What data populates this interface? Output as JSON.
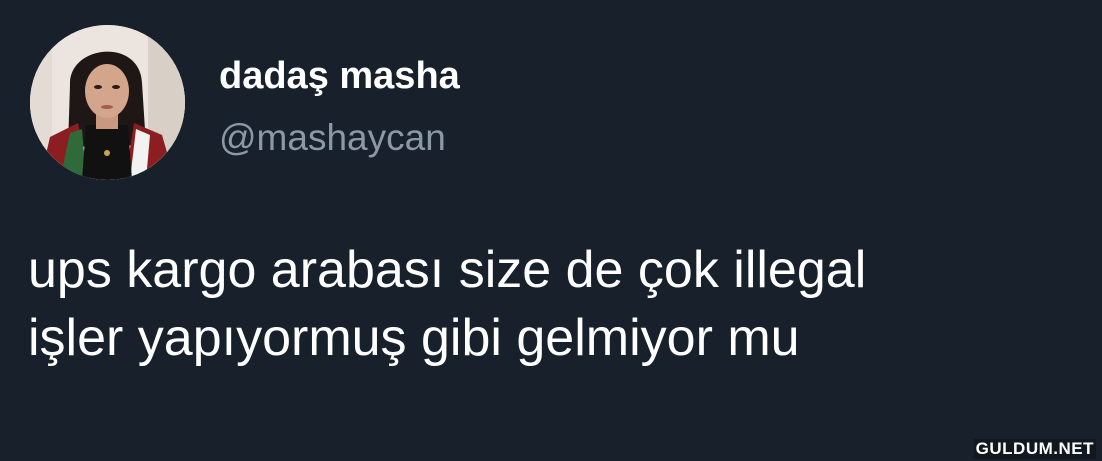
{
  "tweet": {
    "author": {
      "display_name": "dadaş masha",
      "handle": "@mashaycan"
    },
    "text_lines": [
      "ups kargo arabası size de çok illegal",
      "işler yapıyormuş gibi gelmiyor mu"
    ]
  },
  "watermark": "GULDUM.NET",
  "colors": {
    "background": "#17202b",
    "name": "#ffffff",
    "handle": "#8b98a5",
    "text": "#ffffff"
  }
}
